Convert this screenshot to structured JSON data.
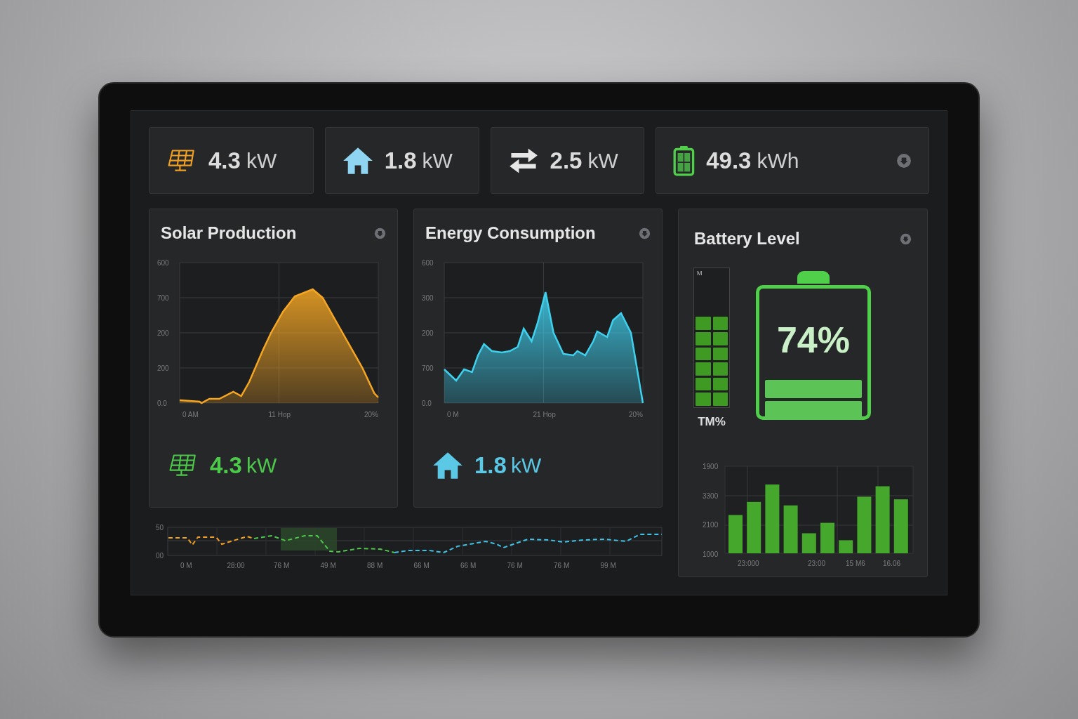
{
  "stats": [
    {
      "kind": "solar",
      "value": "4.3",
      "unit": "kW",
      "menu": false
    },
    {
      "kind": "home",
      "value": "1.8",
      "unit": "kW",
      "menu": false
    },
    {
      "kind": "transfer",
      "value": "2.5",
      "unit": "kW",
      "menu": false
    },
    {
      "kind": "battery",
      "value": "49.3",
      "unit": "kWh",
      "menu": true
    }
  ],
  "panels": [
    {
      "kind": "solar",
      "title": "Solar Production",
      "color": "#f5a623",
      "y_labels": [
        "600",
        "700",
        "200",
        "200",
        "0.0"
      ],
      "x_labels": [
        "0 AM",
        "11 Hop",
        "20%"
      ],
      "summary": {
        "value": "4.3",
        "unit": "kW",
        "color": "#4cc94a"
      }
    },
    {
      "kind": "consumption",
      "title": "Energy Consumption",
      "color": "#3fd0ee",
      "y_labels": [
        "600",
        "300",
        "200",
        "700",
        "0.0"
      ],
      "x_labels": [
        "0 M",
        "21 Hop",
        "20%"
      ],
      "summary": {
        "value": "1.8",
        "unit": "kW",
        "color": "#5bc8e6"
      }
    }
  ],
  "trend": {
    "y_labels": [
      "50",
      "00"
    ],
    "x_labels": [
      "0 M",
      "28:00",
      "76 M",
      "49 M",
      "88 M",
      "66 M",
      "66 M",
      "76 M",
      "76 M",
      "99 M"
    ]
  },
  "battery": {
    "title": "Battery Level",
    "meter": {
      "top_label": "M",
      "caption": "TM%"
    },
    "reading": "74%",
    "bars": {
      "y_labels": [
        "1900",
        "3300",
        "2100",
        "1000"
      ],
      "x_labels": [
        "23:000",
        "23:00",
        "15 M6",
        "16.06"
      ]
    }
  }
}
